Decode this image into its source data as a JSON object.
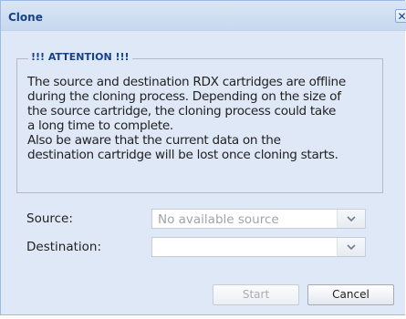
{
  "dialog": {
    "title": "Clone",
    "close_glyph": "✕",
    "close_icon": "close-icon"
  },
  "attention": {
    "legend": "!!! ATTENTION !!!",
    "message": "The source and destination RDX cartridges are offline\nduring the cloning process. Depending on the size of\nthe source cartridge, the cloning process could take\na long time to complete.\nAlso be aware that the current data on the\ndestination cartridge will be lost once cloning starts."
  },
  "form": {
    "source_label": "Source:",
    "source_value": "No available source",
    "destination_label": "Destination:",
    "destination_value": "",
    "dropdown_icon": "chevron-down-icon"
  },
  "buttons": {
    "start_label": "Start",
    "start_enabled": false,
    "cancel_label": "Cancel"
  },
  "colors": {
    "title_text": "#15428b",
    "dialog_background": "#dfe8f6",
    "disabled_text": "#a0a4ab"
  }
}
